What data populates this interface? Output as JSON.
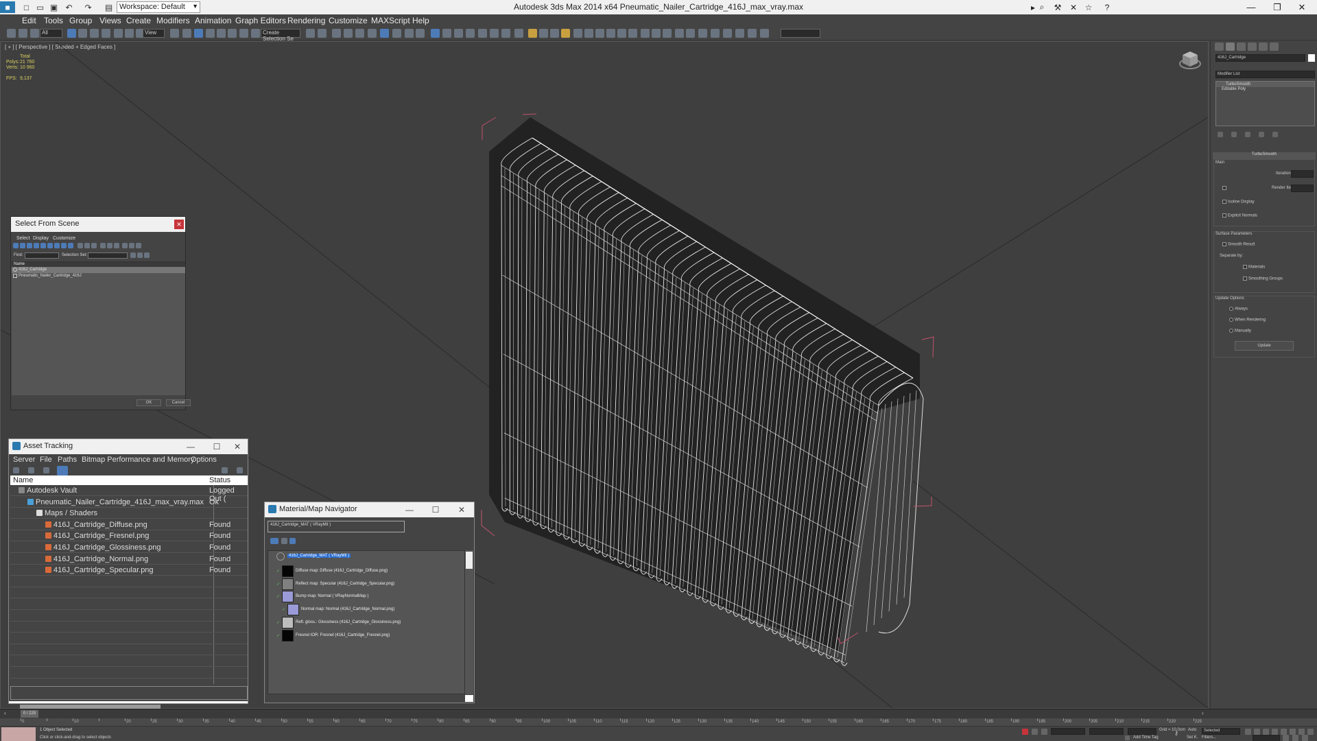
{
  "app": {
    "title": "Autodesk 3ds Max  2014 x64     Pneumatic_Nailer_Cartridge_416J_max_vray.max",
    "workspace": "Workspace: Default"
  },
  "menu": [
    "Edit",
    "Tools",
    "Group",
    "Views",
    "Create",
    "Modifiers",
    "Animation",
    "Graph Editors",
    "Rendering",
    "Customize",
    "MAXScript",
    "Help"
  ],
  "toolbar": {
    "select_filter": "All",
    "view_dropdown": "View",
    "selection_set": "Create Selection Se"
  },
  "viewport": {
    "label": "[ + ] [ Perspective ] [ Shaded + Edged Faces ]",
    "stats": {
      "total_label": "Total",
      "polys_label": "Polys:",
      "polys": "21 760",
      "verts_label": "Verts:",
      "verts": "10 960",
      "fps_label": "FPS:",
      "fps": "9,137"
    }
  },
  "command_panel": {
    "object_name": "416J_Cartridge",
    "modifier_list": "Modifier List",
    "stack": [
      "TurboSmooth",
      "Editable Poly"
    ],
    "rollout_title": "TurboSmooth",
    "main_label": "Main",
    "iterations_label": "Iterations:",
    "render_iters_label": "Render Iters:",
    "isoline": "Isoline Display",
    "explicit_normals": "Explicit Normals",
    "surface_params": "Surface Parameters",
    "smooth_result": "Smooth Result",
    "separate_by": "Separate by:",
    "materials": "Materials",
    "smoothing_groups": "Smoothing Groups",
    "update_options": "Update Options",
    "always": "Always",
    "when_rendering": "When Rendering",
    "manually": "Manually",
    "update_btn": "Update"
  },
  "select_from_scene": {
    "title": "Select From Scene",
    "menu": [
      "Select",
      "Display",
      "Customize"
    ],
    "find_label": "Find:",
    "selection_set": "Selection Set:",
    "col_name": "Name",
    "items": [
      "416J_Cartridge",
      "Pneumatic_Nailer_Cartridge_416J"
    ],
    "ok": "OK",
    "cancel": "Cancel"
  },
  "asset_tracking": {
    "title": "Asset Tracking",
    "menu": [
      "Server",
      "File",
      "Paths",
      "Bitmap Performance and Memory",
      "Options"
    ],
    "col_name": "Name",
    "col_status": "Status",
    "rows": [
      {
        "name": "Autodesk Vault",
        "status": "Logged Out (",
        "indent": 0
      },
      {
        "name": "Pneumatic_Nailer_Cartridge_416J_max_vray.max",
        "status": "Ok",
        "indent": 1
      },
      {
        "name": "Maps / Shaders",
        "status": "",
        "indent": 2
      },
      {
        "name": "416J_Cartridge_Diffuse.png",
        "status": "Found",
        "indent": 3
      },
      {
        "name": "416J_Cartridge_Fresnel.png",
        "status": "Found",
        "indent": 3
      },
      {
        "name": "416J_Cartridge_Glossiness.png",
        "status": "Found",
        "indent": 3
      },
      {
        "name": "416J_Cartridge_Normal.png",
        "status": "Found",
        "indent": 3
      },
      {
        "name": "416J_Cartridge_Specular.png",
        "status": "Found",
        "indent": 3
      }
    ]
  },
  "material_navigator": {
    "title": "Material/Map Navigator",
    "field": "416J_Cartridge_MAT  ( VRayMtl )",
    "root": "416J_Cartridge_MAT  ( VRayMtl )",
    "nodes": [
      {
        "label": "Diffuse map: Diffuse (416J_Cartridge_Diffuse.png)",
        "color": "#050505",
        "indent": 0
      },
      {
        "label": "Reflect map: Specular (416J_Cartridge_Specular.png)",
        "color": "#808080",
        "indent": 0
      },
      {
        "label": "Bump map: Normal  ( VRayNormalMap )",
        "color": "#9a9ad8",
        "indent": 0
      },
      {
        "label": "Normal map: Normal (416J_Cartridge_Normal.png)",
        "color": "#9a9ad8",
        "indent": 1
      },
      {
        "label": "Refl. gloss.: Glossiness (416J_Cartridge_Glossiness.png)",
        "color": "#bdbdbd",
        "indent": 0
      },
      {
        "label": "Fresnel IOR: Fresnel (416J_Cartridge_Fresnel.png)",
        "color": "#050505",
        "indent": 0
      }
    ]
  },
  "timeline": {
    "frame": "0 / 225",
    "ticks": [
      "0",
      "10",
      "20",
      "25",
      "30",
      "35",
      "40",
      "45",
      "50",
      "55",
      "60",
      "65",
      "70",
      "75",
      "80",
      "85",
      "90",
      "95",
      "100",
      "105",
      "110",
      "115",
      "120",
      "125",
      "130",
      "135",
      "140",
      "145",
      "150",
      "155",
      "160",
      "165",
      "170",
      "175",
      "180",
      "185",
      "190",
      "195",
      "200",
      "205",
      "210",
      "215",
      "220",
      "225"
    ]
  },
  "status": {
    "selected": "1 Object Selected",
    "prompt": "Click or click-and-drag to select objects",
    "grid": "Grid = 10,0cm",
    "add_time_tag": "Add Time Tag",
    "auto": "Auto",
    "set_k": "Set K.",
    "selected_dd": "Selected",
    "filters": "Filters..."
  }
}
